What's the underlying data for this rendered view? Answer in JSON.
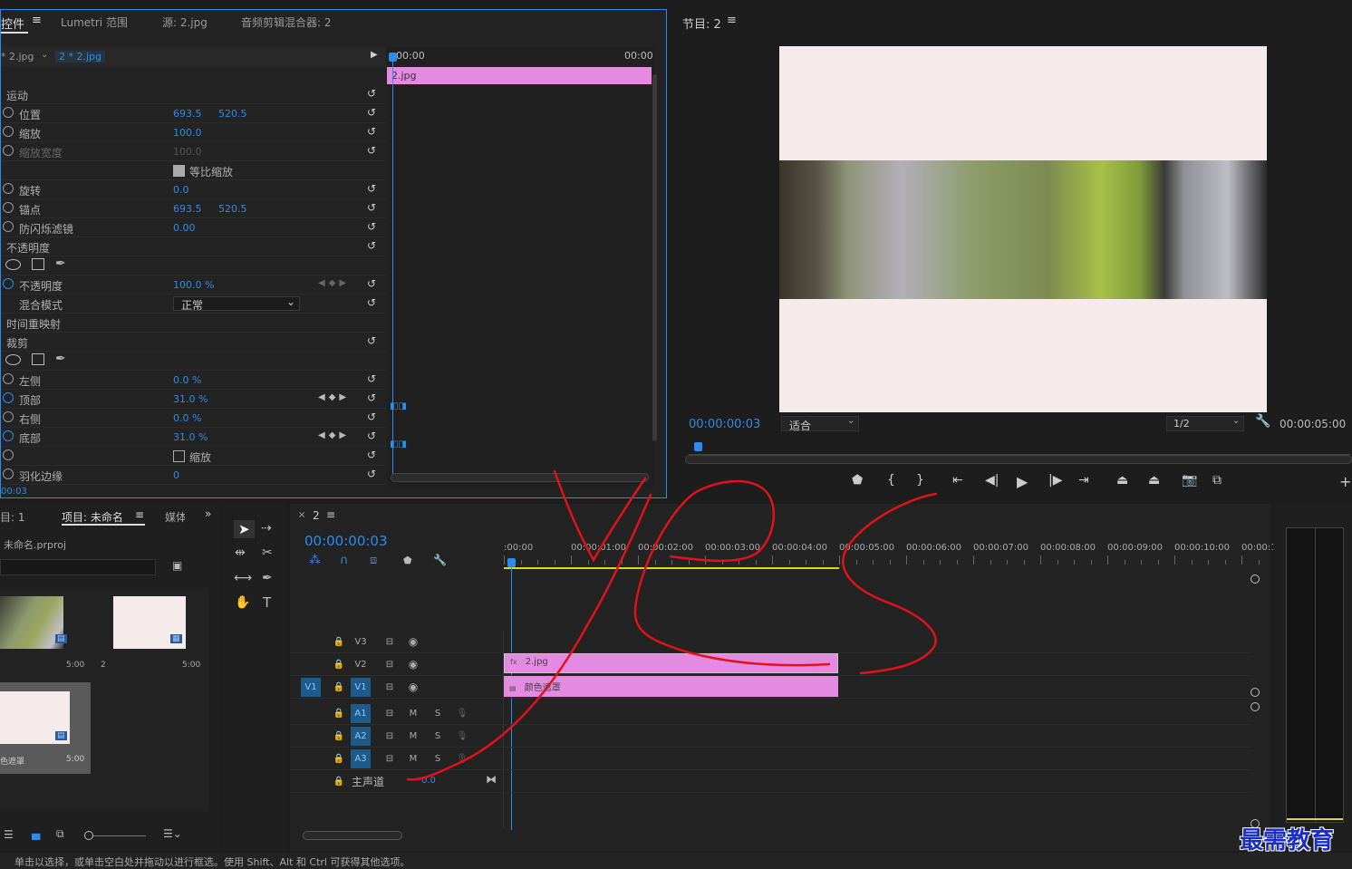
{
  "effect_controls": {
    "tab_active": "控件",
    "tab_lumetri": "Lumetri 范围",
    "tab_source": "源: 2.jpg",
    "tab_audio": "音频剪辑混合器: 2",
    "master_clip": "* 2.jpg",
    "clip": "2 * 2.jpg",
    "tl_start": "00:00",
    "tl_end": "00:00",
    "clip_bar": "2.jpg",
    "rows": [
      {
        "label": "运动"
      },
      {
        "label": "位置",
        "v1": "693.5",
        "v2": "520.5"
      },
      {
        "label": "缩放",
        "v1": "100.0"
      },
      {
        "label": "缩放宽度",
        "v1": "100.0"
      },
      {
        "label": "等比缩放"
      },
      {
        "label": "旋转",
        "v1": "0.0"
      },
      {
        "label": "锚点",
        "v1": "693.5",
        "v2": "520.5"
      },
      {
        "label": "防闪烁滤镜",
        "v1": "0.00"
      },
      {
        "label": "不透明度"
      },
      {
        "label": ""
      },
      {
        "label": "不透明度",
        "v1": "100.0 %"
      },
      {
        "label": "混合模式",
        "v1": "正常"
      },
      {
        "label": "时间重映射"
      },
      {
        "label": "裁剪"
      },
      {
        "label": ""
      },
      {
        "label": "左侧",
        "v1": "0.0 %"
      },
      {
        "label": "顶部",
        "v1": "31.0 %"
      },
      {
        "label": "右侧",
        "v1": "0.0 %"
      },
      {
        "label": "底部",
        "v1": "31.0 %"
      },
      {
        "label": "缩放"
      },
      {
        "label": "羽化边缘",
        "v1": "0"
      }
    ],
    "timecode": "00:03"
  },
  "program": {
    "title": "节目: 2",
    "timecode": "00:00:00:03",
    "fit": "适合",
    "resolution": "1/2",
    "duration": "00:00:05:00"
  },
  "project": {
    "tab1": "目: 1",
    "tab2": "项目: 未命名",
    "tab3": "媒体",
    "file": "未命名.prproj",
    "items": [
      {
        "name": "",
        "dur": "5:00"
      },
      {
        "name": "2",
        "dur": "5:00"
      },
      {
        "name": "色遮罩",
        "dur": "5:00"
      }
    ]
  },
  "timeline": {
    "tab": "2",
    "timecode": "00:00:00:03",
    "ruler": [
      ":00:00",
      "00:00:01:00",
      "00:00:02:00",
      "00:00:03:00",
      "00:00:04:00",
      "00:00:05:00",
      "00:00:06:00",
      "00:00:07:00",
      "00:00:08:00",
      "00:00:09:00",
      "00:00:10:00",
      "00:00:1"
    ],
    "video_tracks": [
      "V3",
      "V2",
      "V1"
    ],
    "audio_tracks": [
      "A1",
      "A2",
      "A3"
    ],
    "master": "主声道",
    "master_val": "0.0",
    "clip_v2": "2.jpg",
    "clip_v1": "颜色遮罩",
    "src_v1": "V1",
    "m": "M",
    "s": "S"
  },
  "status": "单击以选择，或单击空白处并拖动以进行框选。使用 Shift、Alt 和 Ctrl 可获得其他选项。",
  "watermark": "最需教育",
  "colors": {
    "accent": "#2d8ceb",
    "clip": "#e48ae3",
    "annotation": "#e0121a",
    "frame": "#f6ebeb"
  }
}
